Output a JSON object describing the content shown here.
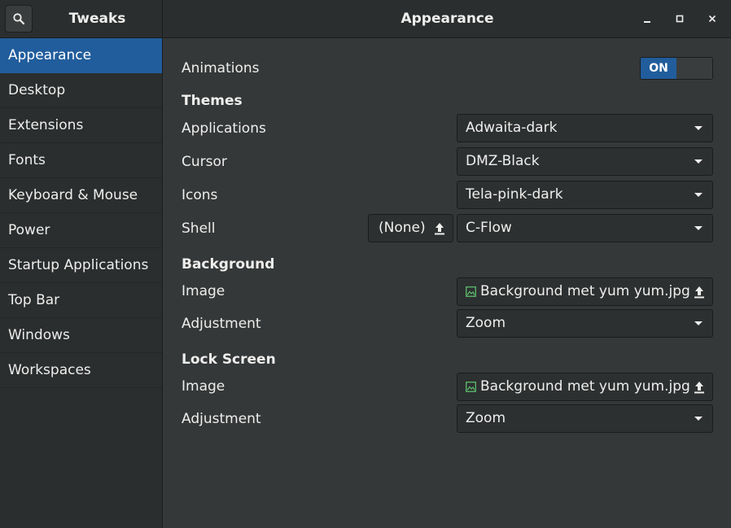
{
  "header": {
    "sidebar_title": "Tweaks",
    "page_title": "Appearance"
  },
  "sidebar": {
    "items": [
      {
        "label": "Appearance",
        "selected": true
      },
      {
        "label": "Desktop"
      },
      {
        "label": "Extensions"
      },
      {
        "label": "Fonts"
      },
      {
        "label": "Keyboard & Mouse"
      },
      {
        "label": "Power"
      },
      {
        "label": "Startup Applications"
      },
      {
        "label": "Top Bar"
      },
      {
        "label": "Windows"
      },
      {
        "label": "Workspaces"
      }
    ]
  },
  "main": {
    "animations": {
      "label": "Animations",
      "switch_text": "ON"
    },
    "themes": {
      "title": "Themes",
      "applications": {
        "label": "Applications",
        "value": "Adwaita-dark"
      },
      "cursor": {
        "label": "Cursor",
        "value": "DMZ-Black"
      },
      "icons": {
        "label": "Icons",
        "value": "Tela-pink-dark"
      },
      "shell": {
        "label": "Shell",
        "none_button": "(None)",
        "value": "C-Flow"
      }
    },
    "background": {
      "title": "Background",
      "image": {
        "label": "Image",
        "file": "Background met yum yum.jpg"
      },
      "adjustment": {
        "label": "Adjustment",
        "value": "Zoom"
      }
    },
    "lock_screen": {
      "title": "Lock Screen",
      "image": {
        "label": "Image",
        "file": "Background met yum yum.jpg"
      },
      "adjustment": {
        "label": "Adjustment",
        "value": "Zoom"
      }
    }
  },
  "colors": {
    "accent": "#215d9c",
    "window_bg": "#353839",
    "sidebar_bg": "#2b2e2f",
    "text": "#eeeeec"
  }
}
